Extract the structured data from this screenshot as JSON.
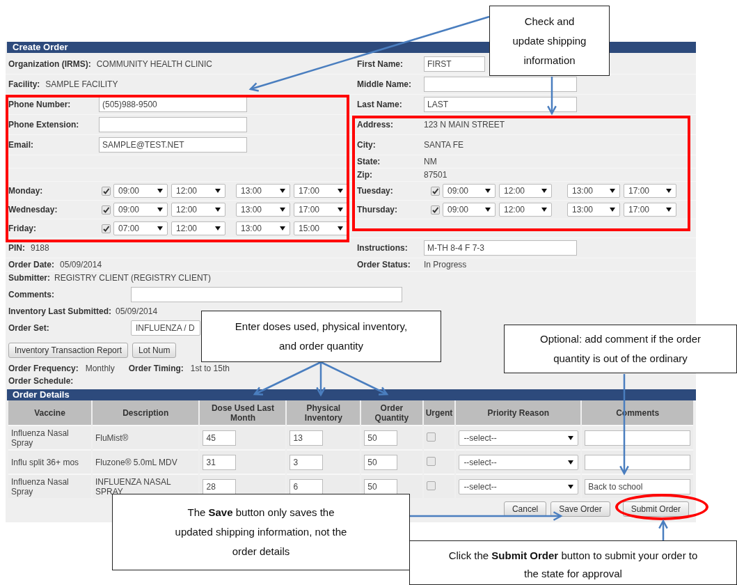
{
  "create_order": {
    "title": "Create Order",
    "rows": [
      {
        "left": {
          "kind": "text",
          "label": "Organization (IRMS):",
          "value": "COMMUNITY HEALTH CLINIC"
        },
        "right": {
          "kind": "input",
          "label": "First Name:",
          "value": "FIRST"
        }
      },
      {
        "left": {
          "kind": "text",
          "label": "Facility:",
          "value": "SAMPLE FACILITY"
        },
        "right": {
          "kind": "input",
          "label": "Middle Name:"
        }
      },
      {
        "left": {
          "kind": "input",
          "label": "Phone Number:",
          "value": "(505)988-9500"
        },
        "right": {
          "kind": "input",
          "label": "Last Name:",
          "value": "LAST"
        }
      },
      {
        "left": {
          "kind": "input",
          "label": "Phone Extension:"
        },
        "right": {
          "kind": "text",
          "label": "Address:",
          "value": "123 N MAIN STREET"
        }
      },
      {
        "left": {
          "kind": "input",
          "label": "Email:",
          "value": "SAMPLE@TEST.NET"
        },
        "right": {
          "kind": "text",
          "label": "City:",
          "value": "SANTA FE"
        }
      },
      {
        "right": {
          "kind": "text",
          "label": "State:",
          "value": "NM"
        }
      },
      {
        "right": {
          "kind": "text",
          "label": "Zip:",
          "value": "87501"
        }
      },
      {
        "left": {
          "kind": "hours",
          "label": "Monday:",
          "checked": true,
          "times": [
            "09:00",
            "12:00",
            "13:00",
            "17:00"
          ]
        },
        "right": {
          "kind": "hours",
          "label": "Tuesday:",
          "checked": true,
          "times": [
            "09:00",
            "12:00",
            "13:00",
            "17:00"
          ]
        }
      },
      {
        "left": {
          "kind": "hours",
          "label": "Wednesday:",
          "checked": true,
          "times": [
            "09:00",
            "12:00",
            "13:00",
            "17:00"
          ]
        },
        "right": {
          "kind": "hours",
          "label": "Thursday:",
          "checked": true,
          "times": [
            "09:00",
            "12:00",
            "13:00",
            "17:00"
          ]
        }
      },
      {
        "left": {
          "kind": "hours",
          "label": "Friday:",
          "checked": true,
          "times": [
            "07:00",
            "12:00",
            "13:00",
            "15:00"
          ]
        }
      },
      {
        "left": {
          "kind": "text",
          "label": "PIN:",
          "value": "9188"
        },
        "right": {
          "kind": "input",
          "label": "Instructions:",
          "value": "M-TH 8-4 F 7-3"
        }
      },
      {
        "left": {
          "kind": "text",
          "label": "Order Date:",
          "value": "05/09/2014"
        },
        "right": {
          "kind": "text",
          "label": "Order Status:",
          "value": "In Progress"
        }
      }
    ],
    "info_rows": [
      {
        "kind": "text",
        "label": "Submitter:",
        "value": "REGISTRY CLIENT (REGISTRY CLIENT)"
      },
      {
        "kind": "input",
        "label": "Comments:"
      },
      {
        "kind": "text",
        "label": "Inventory Last Submitted:",
        "value": "05/09/2014"
      },
      {
        "kind": "select",
        "label": "Order Set:",
        "value": "INFLUENZA / D"
      },
      {
        "kind": "buttons",
        "buttons": [
          "Inventory Transaction Report",
          "Lot Num"
        ]
      },
      {
        "kind": "pairs",
        "pairs": [
          {
            "label": "Order Frequency:",
            "value": "Monthly"
          },
          {
            "label": "Order Timing:",
            "value": "1st to 15th"
          }
        ]
      },
      {
        "kind": "text",
        "label": "Order Schedule:"
      }
    ]
  },
  "order_details": {
    "title": "Order Details",
    "columns": [
      "Vaccine",
      "Description",
      "Dose Used Last Month",
      "Physical Inventory",
      "Order Quantity",
      "Urgent",
      "Priority Reason",
      "Comments"
    ],
    "rows": [
      {
        "vaccine": "Influenza Nasal Spray",
        "description": "FluMist®",
        "dose_used": "45",
        "physical_inventory": "13",
        "order_quantity": "50",
        "urgent": false,
        "priority_reason": "--select--"
      },
      {
        "vaccine": "Influ split 36+ mos",
        "description": "Fluzone® 5.0mL MDV",
        "dose_used": "31",
        "physical_inventory": "3",
        "order_quantity": "50",
        "urgent": false,
        "priority_reason": "--select--"
      },
      {
        "vaccine": "Influenza Nasal Spray",
        "description": "INFLUENZA NASAL SPRAY",
        "dose_used": "28",
        "physical_inventory": "6",
        "order_quantity": "50",
        "urgent": false,
        "priority_reason": "--select--",
        "comment": "Back to school"
      }
    ],
    "actions": [
      "Cancel",
      "Save Order",
      "Submit Order"
    ]
  },
  "callouts": [
    {
      "text": "Check and update shipping information"
    },
    {
      "text": "Enter doses used, physical inventory, and order quantity"
    },
    {
      "text": "Optional:  add comment if the order quantity is out of the ordinary"
    },
    {
      "text": "The **Save** button only saves the updated shipping information, not the order details"
    },
    {
      "text": "Click the **Submit Order** button to submit your order to the state for approval"
    }
  ]
}
